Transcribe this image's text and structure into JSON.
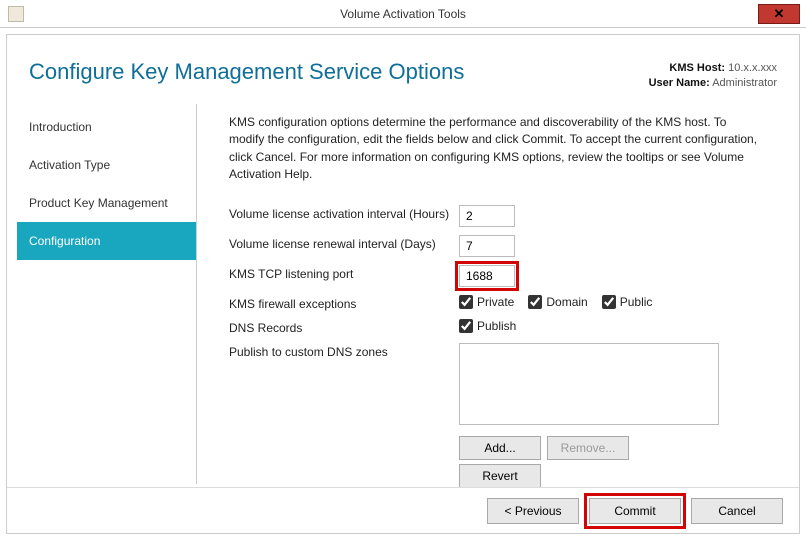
{
  "window": {
    "title": "Volume Activation Tools",
    "close_glyph": "✕"
  },
  "header": {
    "page_title": "Configure Key Management Service Options",
    "kms_host_label": "KMS Host:",
    "kms_host_value": "10.x.x.xxx",
    "user_name_label": "User Name:",
    "user_name_value": "Administrator"
  },
  "sidebar": {
    "items": [
      {
        "label": "Introduction"
      },
      {
        "label": "Activation Type"
      },
      {
        "label": "Product Key Management"
      },
      {
        "label": "Configuration"
      }
    ],
    "selected_index": 3
  },
  "intro": "KMS configuration options determine the performance and discoverability of the KMS host. To modify the configuration, edit the fields below and click Commit. To accept the current configuration, click Cancel. For more information on configuring KMS options, review the tooltips or see Volume Activation Help.",
  "form": {
    "activation_interval_label": "Volume license activation interval (Hours)",
    "activation_interval_value": "2",
    "renewal_interval_label": "Volume license renewal interval (Days)",
    "renewal_interval_value": "7",
    "tcp_port_label": "KMS TCP listening port",
    "tcp_port_value": "1688",
    "firewall_label": "KMS firewall exceptions",
    "firewall_private": "Private",
    "firewall_domain": "Domain",
    "firewall_public": "Public",
    "dns_records_label": "DNS Records",
    "dns_publish": "Publish",
    "zones_label": "Publish to custom DNS zones"
  },
  "zone_buttons": {
    "add": "Add...",
    "remove": "Remove...",
    "revert": "Revert"
  },
  "bottom": {
    "previous": "<  Previous",
    "commit": "Commit",
    "cancel": "Cancel"
  }
}
